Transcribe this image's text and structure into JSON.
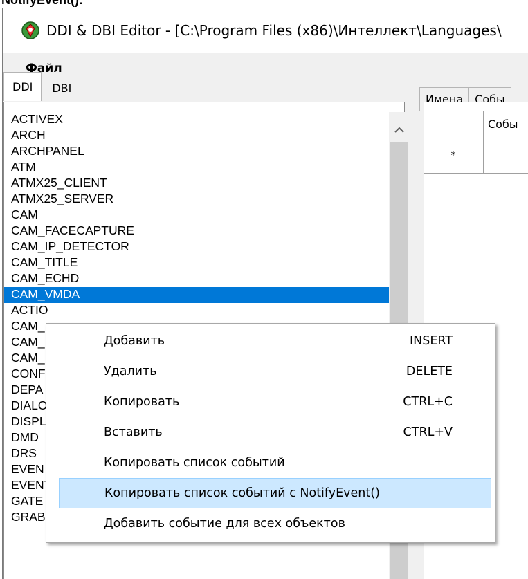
{
  "top_caption": "NotifyEvent():",
  "window": {
    "title": "DDI & DBI Editor - [C:\\Program Files (x86)\\Интеллект\\Languages\\"
  },
  "menubar": {
    "file": "Файл"
  },
  "left_tabs": [
    "DDI",
    "DBI"
  ],
  "list": {
    "items": [
      "ACTIVEX",
      "ARCH",
      "ARCHPANEL",
      "ATM",
      "ATMX25_CLIENT",
      "ATMX25_SERVER",
      "CAM",
      "CAM_FACECAPTURE",
      "CAM_IP_DETECTOR",
      "CAM_TITLE",
      "CAM_ECHD",
      "CAM_VMDA",
      "ACTIO",
      "CAM_",
      "CAM_",
      "CAM_",
      "CONF",
      "DEPA",
      "DIALO",
      "DISPL",
      "DMD",
      "DRS",
      "EVEN",
      "EVENT_VIEWER",
      "GATE",
      "GRABBER"
    ],
    "selected_index": 11
  },
  "right_tabs": [
    "Имена",
    "Собы"
  ],
  "grid": {
    "column_header": "Собы",
    "new_row_marker": "*"
  },
  "context_menu": {
    "items": [
      {
        "label": "Добавить",
        "shortcut": "INSERT"
      },
      {
        "label": "Удалить",
        "shortcut": "DELETE"
      },
      {
        "label": "Копировать",
        "shortcut": "CTRL+C"
      },
      {
        "label": "Вставить",
        "shortcut": "CTRL+V"
      },
      {
        "label": "Копировать список событий",
        "shortcut": ""
      },
      {
        "label": "Копировать список событий с NotifyEvent()",
        "shortcut": ""
      },
      {
        "label": "Добавить событие для всех объектов",
        "shortcut": ""
      }
    ],
    "highlighted_index": 5
  },
  "colors": {
    "selection": "#0078d7",
    "menu_hover": "#cce8ff",
    "menu_hover_border": "#99d1ff"
  }
}
